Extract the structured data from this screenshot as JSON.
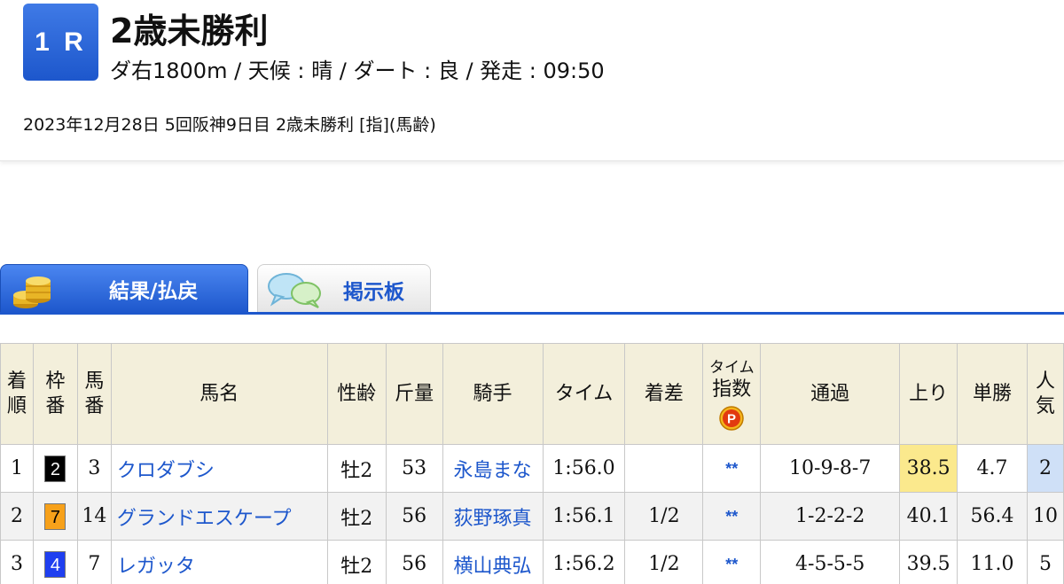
{
  "race": {
    "number": "1 R",
    "title": "2歳未勝利",
    "info": "ダ右1800m / 天候 : 晴 / ダート : 良 / 発走 : 09:50",
    "date_line": "2023年12月28日 5回阪神9日目 2歳未勝利  [指](馬齢)"
  },
  "tabs": {
    "results_label": "結果/払戻",
    "board_label": "掲示板"
  },
  "table": {
    "headers": {
      "rank": [
        "着",
        "順"
      ],
      "waku": [
        "枠",
        "番"
      ],
      "umaban": [
        "馬",
        "番"
      ],
      "horse": "馬名",
      "sex_age": "性齢",
      "weight": "斤量",
      "jockey": "騎手",
      "time": "タイム",
      "margin": "着差",
      "time_index": [
        "タイム",
        "指数"
      ],
      "passing": "通過",
      "last3f": "上り",
      "win_odds": "単勝",
      "popularity": [
        "人",
        "気"
      ]
    },
    "rows": [
      {
        "rank": "1",
        "waku": "2",
        "umaban": "3",
        "horse": "クロダブシ",
        "sex_age": "牡2",
        "weight": "53",
        "jockey": "永島まな",
        "time": "1:56.0",
        "margin": "",
        "time_index": "**",
        "passing": "10-9-8-7",
        "last3f": "38.5",
        "win_odds": "4.7",
        "popularity": "2"
      },
      {
        "rank": "2",
        "waku": "7",
        "umaban": "14",
        "horse": "グランドエスケープ",
        "sex_age": "牡2",
        "weight": "56",
        "jockey": "荻野琢真",
        "time": "1:56.1",
        "margin": "1/2",
        "time_index": "**",
        "passing": "1-2-2-2",
        "last3f": "40.1",
        "win_odds": "56.4",
        "popularity": "10"
      },
      {
        "rank": "3",
        "waku": "4",
        "umaban": "7",
        "horse": "レガッタ",
        "sex_age": "牡2",
        "weight": "56",
        "jockey": "横山典弘",
        "time": "1:56.2",
        "margin": "1/2",
        "time_index": "**",
        "passing": "4-5-5-5",
        "last3f": "39.5",
        "win_odds": "11.0",
        "popularity": "5"
      }
    ]
  },
  "colors": {
    "accent_blue": "#1d57cc",
    "header_bg": "#f3efdb",
    "waku_2": "#000000",
    "waku_7": "#f7a11a",
    "waku_4": "#1f3ff0",
    "highlight_fastest": "#fbe98d",
    "highlight_popularity": "#cfe0f7"
  },
  "icons": {
    "results_tab": "gold-coins-icon",
    "board_tab": "speech-bubbles-icon",
    "time_index": "premium-p-icon"
  }
}
